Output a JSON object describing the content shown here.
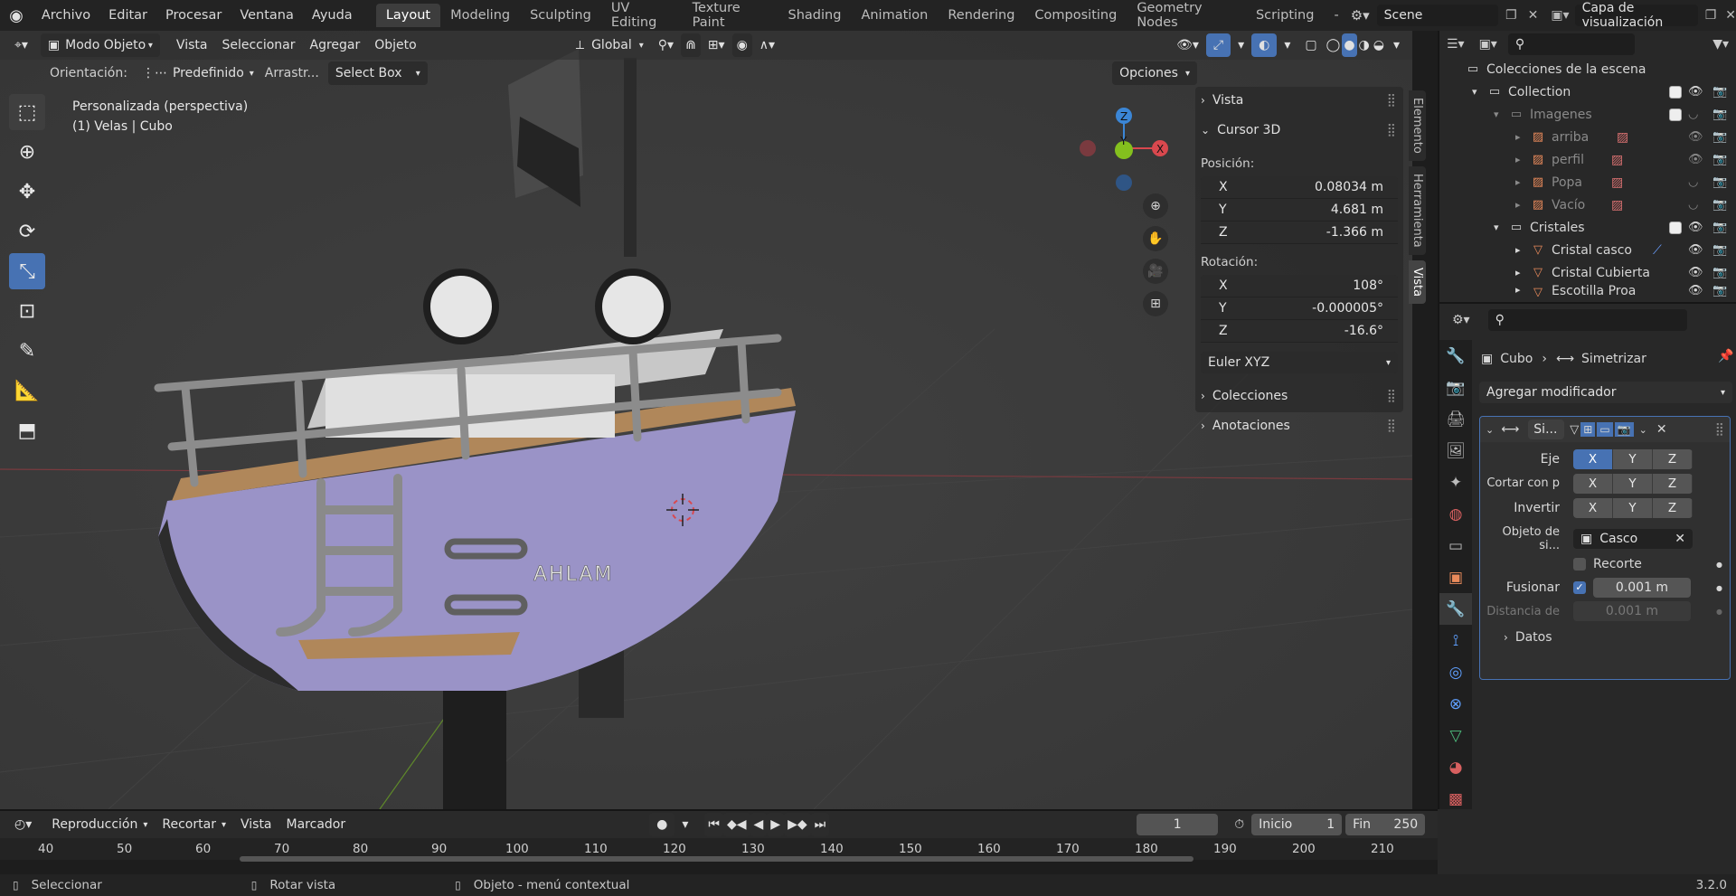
{
  "topbar": {
    "menus": [
      "Archivo",
      "Editar",
      "Procesar",
      "Ventana",
      "Ayuda"
    ],
    "workspaces": [
      "Layout",
      "Modeling",
      "Sculpting",
      "UV Editing",
      "Texture Paint",
      "Shading",
      "Animation",
      "Rendering",
      "Compositing",
      "Geometry Nodes",
      "Scripting"
    ],
    "active_workspace": "Layout",
    "more": "-",
    "scene": "Scene",
    "view_layer": "Capa de visualización"
  },
  "viewport_header": {
    "mode": "Modo Objeto",
    "menus": [
      "Vista",
      "Seleccionar",
      "Agregar",
      "Objeto"
    ],
    "transform_orientation": "Global"
  },
  "tool_settings": {
    "orientation_label": "Orientación:",
    "orientation_value": "Predefinido",
    "drag_label": "Arrastr...",
    "drag_value": "Select Box",
    "options": "Opciones"
  },
  "viewport": {
    "view_name": "Personalizada (perspectiva)",
    "object_info": "(1) Velas | Cubo",
    "boat_name": "AHLAM",
    "gizmo": {
      "z": "Z",
      "y": "Y",
      "x": "X"
    },
    "colors": {
      "x": "#d9484e",
      "y": "#84c01e",
      "z": "#3b86d6",
      "hull": "#9a93c7",
      "deck": "#b0875a"
    }
  },
  "npanel": {
    "vista": "Vista",
    "cursor": "Cursor 3D",
    "position_label": "Posición:",
    "position": [
      {
        "axis": "X",
        "value": "0.08034 m"
      },
      {
        "axis": "Y",
        "value": "4.681 m"
      },
      {
        "axis": "Z",
        "value": "-1.366 m"
      }
    ],
    "rotation_label": "Rotación:",
    "rotation": [
      {
        "axis": "X",
        "value": "108°"
      },
      {
        "axis": "Y",
        "value": "-0.000005°"
      },
      {
        "axis": "Z",
        "value": "-16.6°"
      }
    ],
    "rotation_mode": "Euler XYZ",
    "collections": "Colecciones",
    "annotations": "Anotaciones",
    "tabs": [
      "Elemento",
      "Herramienta",
      "Vista"
    ],
    "active_tab": "Vista"
  },
  "outliner": {
    "root": "Colecciones de la escena",
    "items": [
      {
        "label": "Collection",
        "indent": 0,
        "dim": false
      },
      {
        "label": "Imagenes",
        "indent": 1,
        "dim": true
      },
      {
        "label": "arriba",
        "indent": 2,
        "dim": true
      },
      {
        "label": "perfil",
        "indent": 2,
        "dim": true
      },
      {
        "label": "Popa",
        "indent": 2,
        "dim": true
      },
      {
        "label": "Vacío",
        "indent": 2,
        "dim": true
      },
      {
        "label": "Cristales",
        "indent": 1,
        "dim": false
      },
      {
        "label": "Cristal casco",
        "indent": 2,
        "dim": false
      },
      {
        "label": "Cristal Cubierta",
        "indent": 2,
        "dim": false
      },
      {
        "label": "Escotilla Proa",
        "indent": 2,
        "dim": false
      }
    ]
  },
  "properties": {
    "breadcrumb_object": "Cubo",
    "breadcrumb_modifier": "Simetrizar",
    "add_modifier": "Agregar modificador",
    "modifier_name": "Si...",
    "axis_label": "Eje",
    "bisect_label": "Cortar con p",
    "flip_label": "Invertir",
    "mirror_object_label": "Objeto de si...",
    "mirror_object": "Casco",
    "clipping": "Recorte",
    "merge_label": "Fusionar",
    "merge_value": "0.001 m",
    "bisect_distance_label": "Distancia de",
    "bisect_distance_value": "0.001 m",
    "data": "Datos",
    "axes": [
      "X",
      "Y",
      "Z"
    ]
  },
  "timeline": {
    "menus": [
      "Reproducción",
      "Recortar",
      "Vista",
      "Marcador"
    ],
    "current_frame": "1",
    "start_label": "Inicio",
    "start": "1",
    "end_label": "Fin",
    "end": "250",
    "ticks": [
      "40",
      "50",
      "60",
      "70",
      "80",
      "90",
      "100",
      "110",
      "120",
      "130",
      "140",
      "150",
      "160",
      "170",
      "180",
      "190",
      "200",
      "210"
    ]
  },
  "statusbar": {
    "select": "Seleccionar",
    "rotate": "Rotar vista",
    "context": "Objeto - menú contextual",
    "version": "3.2.0"
  }
}
